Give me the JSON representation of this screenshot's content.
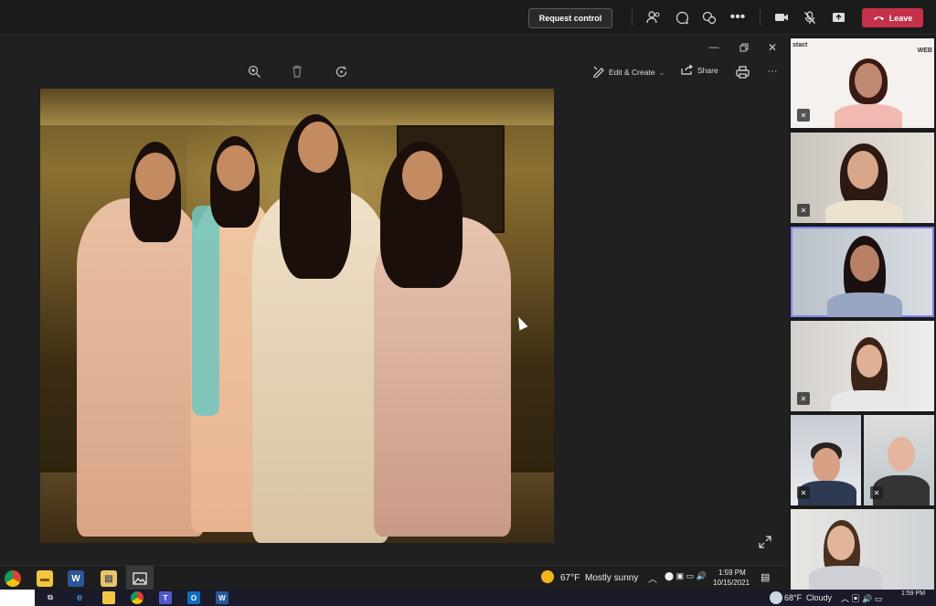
{
  "teams": {
    "request_control_label": "Request control",
    "leave_label": "Leave",
    "icons": [
      "people-icon",
      "chat-icon",
      "reactions-icon",
      "more-icon",
      "camera-icon",
      "mic-off-icon",
      "share-icon",
      "phone-icon"
    ],
    "colors": {
      "leave": "#c4314b",
      "bar": "#1b1b1b",
      "active_tile": "#7f85f5"
    }
  },
  "photos": {
    "toolbar": {
      "edit_create_label": "Edit & Create",
      "share_label": "Share"
    },
    "window_controls": [
      "minimize-icon",
      "restore-icon",
      "close-icon"
    ],
    "photo_description_icons": [
      "zoom-in-icon",
      "delete-icon",
      "rotate-icon",
      "print-icon",
      "more-icon",
      "expand-icon"
    ]
  },
  "participants": {
    "logo_text_left": "stact",
    "logo_text_right": "WEB",
    "tiles": [
      {
        "name": "participant-1",
        "muted": true
      },
      {
        "name": "participant-2",
        "muted": true
      },
      {
        "name": "participant-3",
        "muted": false,
        "active": true
      },
      {
        "name": "participant-4",
        "muted": true
      },
      {
        "name": "participant-5",
        "muted": true
      },
      {
        "name": "participant-6",
        "muted": true
      },
      {
        "name": "participant-7",
        "muted": false
      }
    ]
  },
  "taskbar_remote": {
    "weather_temp": "67°F",
    "weather_text": "Mostly sunny",
    "time": "1:59 PM",
    "date": "10/15/2021"
  },
  "taskbar_local": {
    "weather_temp": "68°F",
    "weather_text": "Cloudy",
    "time": "1:59 PM"
  }
}
